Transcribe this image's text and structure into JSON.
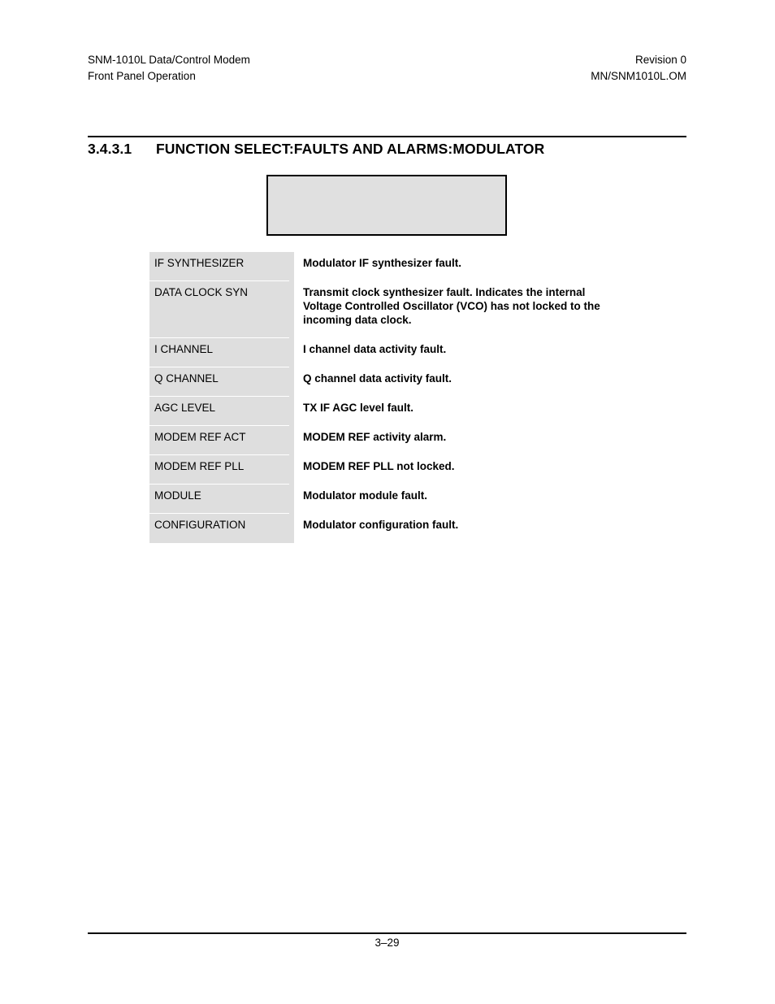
{
  "header": {
    "left_line1": "SNM-1010L Data/Control Modem",
    "left_line2": "Front Panel Operation",
    "right_line1": "Revision 0",
    "right_line2": "MN/SNM1010L.OM"
  },
  "section": {
    "number": "3.4.3.1",
    "title": "FUNCTION SELECT:FAULTS AND ALARMS:MODULATOR"
  },
  "figure": {
    "caption": "",
    "fill_color": "#e0e0e0",
    "border_color": "#000000"
  },
  "table": {
    "term_column_bg": "#dedede",
    "rows": [
      {
        "term": "IF SYNTHESIZER",
        "description_lines": [
          "Modulator IF synthesizer fault."
        ]
      },
      {
        "term": "DATA CLOCK SYN",
        "description_lines": [
          "Transmit clock synthesizer fault. Indicates the internal",
          "Voltage Controlled Oscillator (VCO) has not locked to the",
          "incoming data clock."
        ]
      },
      {
        "term": "I CHANNEL",
        "description_lines": [
          "I channel data activity fault."
        ]
      },
      {
        "term": "Q CHANNEL",
        "description_lines": [
          "Q channel data activity fault."
        ]
      },
      {
        "term": "AGC LEVEL",
        "description_lines": [
          "TX IF AGC level fault."
        ]
      },
      {
        "term": "MODEM REF ACT",
        "description_lines": [
          "MODEM REF activity alarm."
        ]
      },
      {
        "term": "MODEM REF PLL",
        "description_lines": [
          "MODEM REF PLL not locked."
        ]
      },
      {
        "term": "MODULE",
        "description_lines": [
          "Modulator module fault."
        ]
      },
      {
        "term": "CONFIGURATION",
        "description_lines": [
          "Modulator configuration fault."
        ]
      }
    ]
  },
  "footer": {
    "page_number": "3–29"
  }
}
